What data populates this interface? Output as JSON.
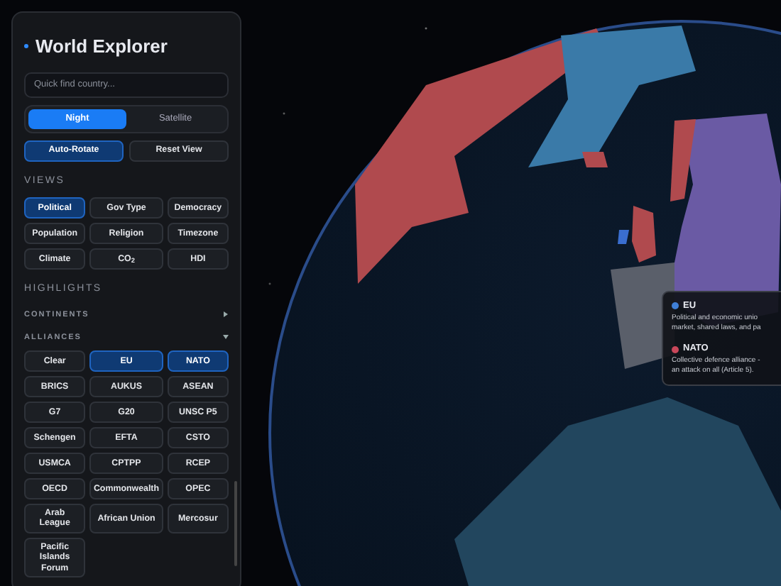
{
  "sidebar": {
    "title": "World Explorer",
    "search": {
      "placeholder": "Quick find country..."
    },
    "modes": [
      {
        "label": "Night",
        "selected": true
      },
      {
        "label": "Satellite",
        "selected": false
      }
    ],
    "actions": [
      {
        "label": "Auto-Rotate",
        "on": true
      },
      {
        "label": "Reset View",
        "on": false
      }
    ],
    "views": {
      "heading": "VIEWS",
      "items": [
        {
          "label": "Political",
          "selected": true
        },
        {
          "label": "Gov Type",
          "selected": false
        },
        {
          "label": "Democracy",
          "selected": false
        },
        {
          "label": "Population",
          "selected": false
        },
        {
          "label": "Religion",
          "selected": false
        },
        {
          "label": "Timezone",
          "selected": false
        },
        {
          "label": "Climate",
          "selected": false
        },
        {
          "label": "CO$_{2}$",
          "selected": false
        },
        {
          "label": "HDI",
          "selected": false
        }
      ]
    },
    "highlights": {
      "heading": "HIGHLIGHTS",
      "groups": [
        {
          "label": "CONTINENTS",
          "expanded": false
        },
        {
          "label": "ALLIANCES",
          "expanded": true,
          "items": [
            {
              "label": "Clear",
              "selected": false
            },
            {
              "label": "EU",
              "selected": true
            },
            {
              "label": "NATO",
              "selected": true
            },
            {
              "label": "BRICS",
              "selected": false
            },
            {
              "label": "AUKUS",
              "selected": false
            },
            {
              "label": "ASEAN",
              "selected": false
            },
            {
              "label": "G7",
              "selected": false
            },
            {
              "label": "G20",
              "selected": false
            },
            {
              "label": "UNSC P5",
              "selected": false
            },
            {
              "label": "Schengen",
              "selected": false
            },
            {
              "label": "EFTA",
              "selected": false
            },
            {
              "label": "CSTO",
              "selected": false
            },
            {
              "label": "USMCA",
              "selected": false
            },
            {
              "label": "CPTPP",
              "selected": false
            },
            {
              "label": "RCEP",
              "selected": false
            },
            {
              "label": "OECD",
              "selected": false
            },
            {
              "label": "Commonwealth",
              "selected": false
            },
            {
              "label": "OPEC",
              "selected": false
            },
            {
              "label": "Arab League",
              "selected": false
            },
            {
              "label": "African Union",
              "selected": false
            },
            {
              "label": "Mercosur",
              "selected": false
            },
            {
              "label": "Pacific Islands Forum",
              "selected": false
            }
          ]
        }
      ]
    }
  },
  "legend": {
    "items": [
      {
        "name": "EU",
        "color": "#3f7fd6",
        "lines": [
          "Political and economic unio",
          "market, shared laws, and pa"
        ]
      },
      {
        "name": "NATO",
        "color": "#c8475a",
        "lines": [
          "Collective defence alliance -",
          "an attack on all (Article 5)."
        ]
      }
    ]
  }
}
